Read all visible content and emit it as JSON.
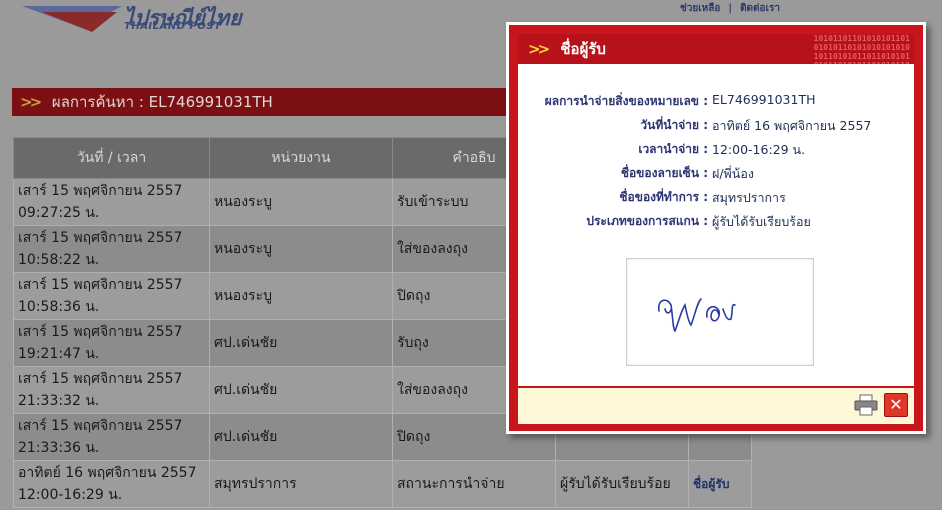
{
  "header": {
    "logo_th": "ไปรษณีย์ไทย",
    "logo_en": "THAILAND POST",
    "links": [
      "ช่วยเหลือ",
      "|",
      "ติดต่อเรา"
    ]
  },
  "result": {
    "label": "ผลการค้นหา : EL746991031TH"
  },
  "table": {
    "headers": [
      "วันที่ / เวลา",
      "หน่วยงาน",
      "คำอธิบ"
    ],
    "rows": [
      {
        "date": "เสาร์ 15 พฤศจิกายน 2557",
        "time": "09:27:25 น.",
        "unit": "หนองระบู",
        "desc": "รับเข้าระบบ",
        "status": "",
        "link": ""
      },
      {
        "date": "เสาร์ 15 พฤศจิกายน 2557",
        "time": "10:58:22 น.",
        "unit": "หนองระบู",
        "desc": "ใส่ของลงถุง",
        "status": "",
        "link": ""
      },
      {
        "date": "เสาร์ 15 พฤศจิกายน 2557",
        "time": "10:58:36 น.",
        "unit": "หนองระบู",
        "desc": "ปิดถุง",
        "status": "",
        "link": ""
      },
      {
        "date": "เสาร์ 15 พฤศจิกายน 2557",
        "time": "19:21:47 น.",
        "unit": "ศป.เด่นชัย",
        "desc": "รับถุง",
        "status": "",
        "link": ""
      },
      {
        "date": "เสาร์ 15 พฤศจิกายน 2557",
        "time": "21:33:32 น.",
        "unit": "ศป.เด่นชัย",
        "desc": "ใส่ของลงถุง",
        "status": "",
        "link": ""
      },
      {
        "date": "เสาร์ 15 พฤศจิกายน 2557",
        "time": "21:33:36 น.",
        "unit": "ศป.เด่นชัย",
        "desc": "ปิดถุง",
        "status": "",
        "link": ""
      },
      {
        "date": "อาทิตย์ 16 พฤศจิกายน 2557",
        "time": "12:00-16:29 น.",
        "unit": "สมุทรปราการ",
        "desc": "สถานะการนำจ่าย",
        "status": "ผู้รับได้รับเรียบร้อย",
        "link": "ชื่อผู้รับ"
      }
    ]
  },
  "modal": {
    "title": "ชื่อผู้รับ",
    "binary": "10101101101010101101\n01010110101010101010\n10110101011011010101\n01011010101101010110",
    "fields": [
      {
        "label": "ผลการนำจ่ายสิ่งของหมายเลข :",
        "value": "EL746991031TH"
      },
      {
        "label": "วันที่นำจ่าย :",
        "value": "อาทิตย์ 16 พฤศจิกายน 2557"
      },
      {
        "label": "เวลานำจ่าย :",
        "value": "12:00-16:29 น."
      },
      {
        "label": "ชื่อของลายเซ็น :",
        "value": "ฝ/พี่น้อง"
      },
      {
        "label": "ชื่อของที่ทำการ :",
        "value": "สมุทรปราการ"
      },
      {
        "label": "ประเภทของการสแกน :",
        "value": "ผู้รับได้รับเรียบร้อย"
      }
    ],
    "close_label": "✕"
  }
}
